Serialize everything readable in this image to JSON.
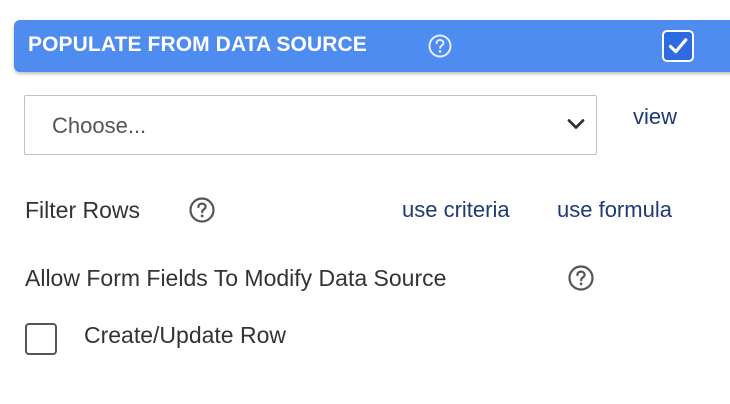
{
  "header": {
    "title": "POPULATE FROM DATA SOURCE",
    "help_icon": "help-circle-icon",
    "checked": true,
    "background": "#4f8cf0"
  },
  "data_source": {
    "placeholder": "Choose...",
    "chevron_icon": "chevron-down-icon",
    "view_link": "view"
  },
  "filter": {
    "label": "Filter Rows",
    "help_icon": "help-circle-icon",
    "use_criteria": "use criteria",
    "use_formula": "use formula"
  },
  "modify": {
    "label": "Allow Form Fields To Modify Data Source",
    "help_icon": "help-circle-icon",
    "create_update_label": "Create/Update Row",
    "create_update_checked": false
  },
  "colors": {
    "accent": "#4f8cf0",
    "link": "#1f3a78",
    "text": "#333333"
  }
}
